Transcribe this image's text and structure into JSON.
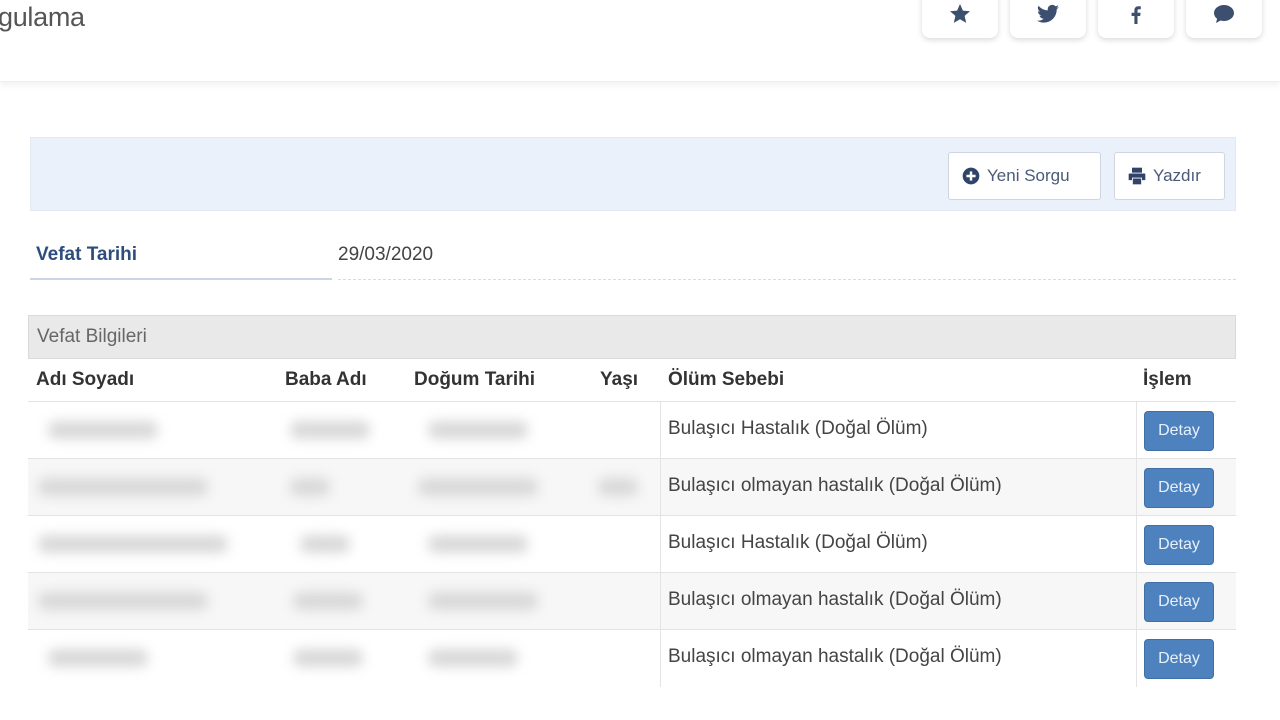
{
  "header": {
    "subtitle": "gulama",
    "social": [
      {
        "icon": "star-icon"
      },
      {
        "icon": "twitter-icon"
      },
      {
        "icon": "facebook-icon"
      },
      {
        "icon": "comment-icon"
      }
    ]
  },
  "toolbar": {
    "new_query_label": "Yeni Sorgu",
    "print_label": "Yazdır"
  },
  "death_date": {
    "label": "Vefat Tarihi",
    "value": "29/03/2020"
  },
  "table": {
    "title": "Vefat Bilgileri",
    "columns": [
      "Adı Soyadı",
      "Baba Adı",
      "Doğum Tarihi",
      "Yaşı",
      "Ölüm Sebebi",
      "İşlem"
    ],
    "rows": [
      {
        "cause": "Bulaşıcı Hastalık (Doğal Ölüm)",
        "action": "Detay"
      },
      {
        "cause": "Bulaşıcı olmayan hastalık (Doğal Ölüm)",
        "action": "Detay"
      },
      {
        "cause": "Bulaşıcı Hastalık (Doğal Ölüm)",
        "action": "Detay"
      },
      {
        "cause": "Bulaşıcı olmayan hastalık (Doğal Ölüm)",
        "action": "Detay"
      },
      {
        "cause": "Bulaşıcı olmayan hastalık (Doğal Ölüm)",
        "action": "Detay"
      }
    ]
  },
  "colors": {
    "accent": "#4d82be",
    "label": "#2e4d7d",
    "toolbar_bg": "#eaf1fb"
  }
}
